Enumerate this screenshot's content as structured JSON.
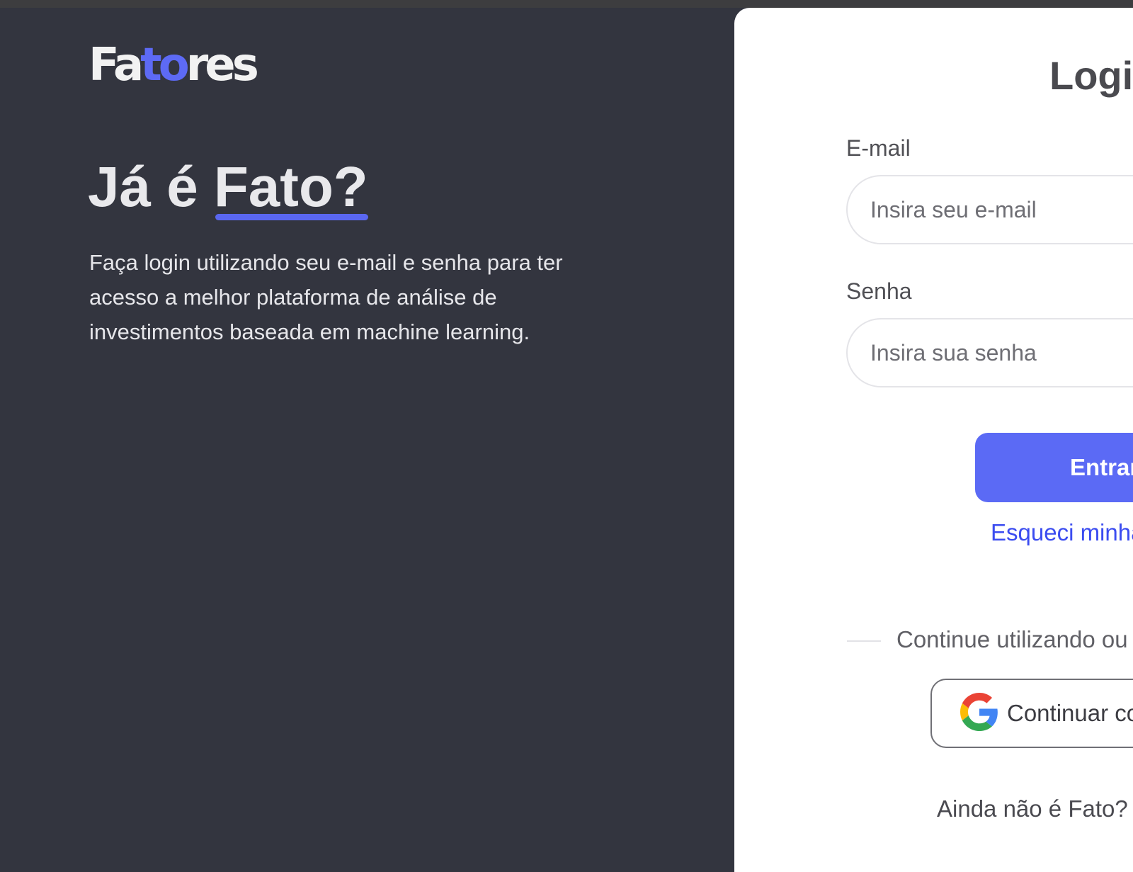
{
  "brand": {
    "logo_part1": "Fa",
    "logo_accent": "to",
    "logo_part2": "res",
    "accent_color": "#5d6af5"
  },
  "hero": {
    "headline_prefix": "Já é ",
    "headline_highlight": "Fato?",
    "description": "Faça login utilizando seu e-mail e senha para ter acesso a melhor plataforma de análise de investimentos baseada em machine learning."
  },
  "login": {
    "title": "Logi",
    "email_label": "E-mail",
    "email_placeholder": "Insira seu e-mail",
    "password_label": "Senha",
    "password_placeholder": "Insira sua senha",
    "submit_label": "Entrar",
    "forgot_label": "Esqueci minha",
    "divider_label": "Continue utilizando ou",
    "google_label": "Continuar co",
    "google_icon": "google-icon",
    "signup_prompt": "Ainda não é Fato?"
  },
  "colors": {
    "page_background": "#33353f",
    "button_primary": "#5b6af5",
    "link": "#3b4cf0"
  }
}
